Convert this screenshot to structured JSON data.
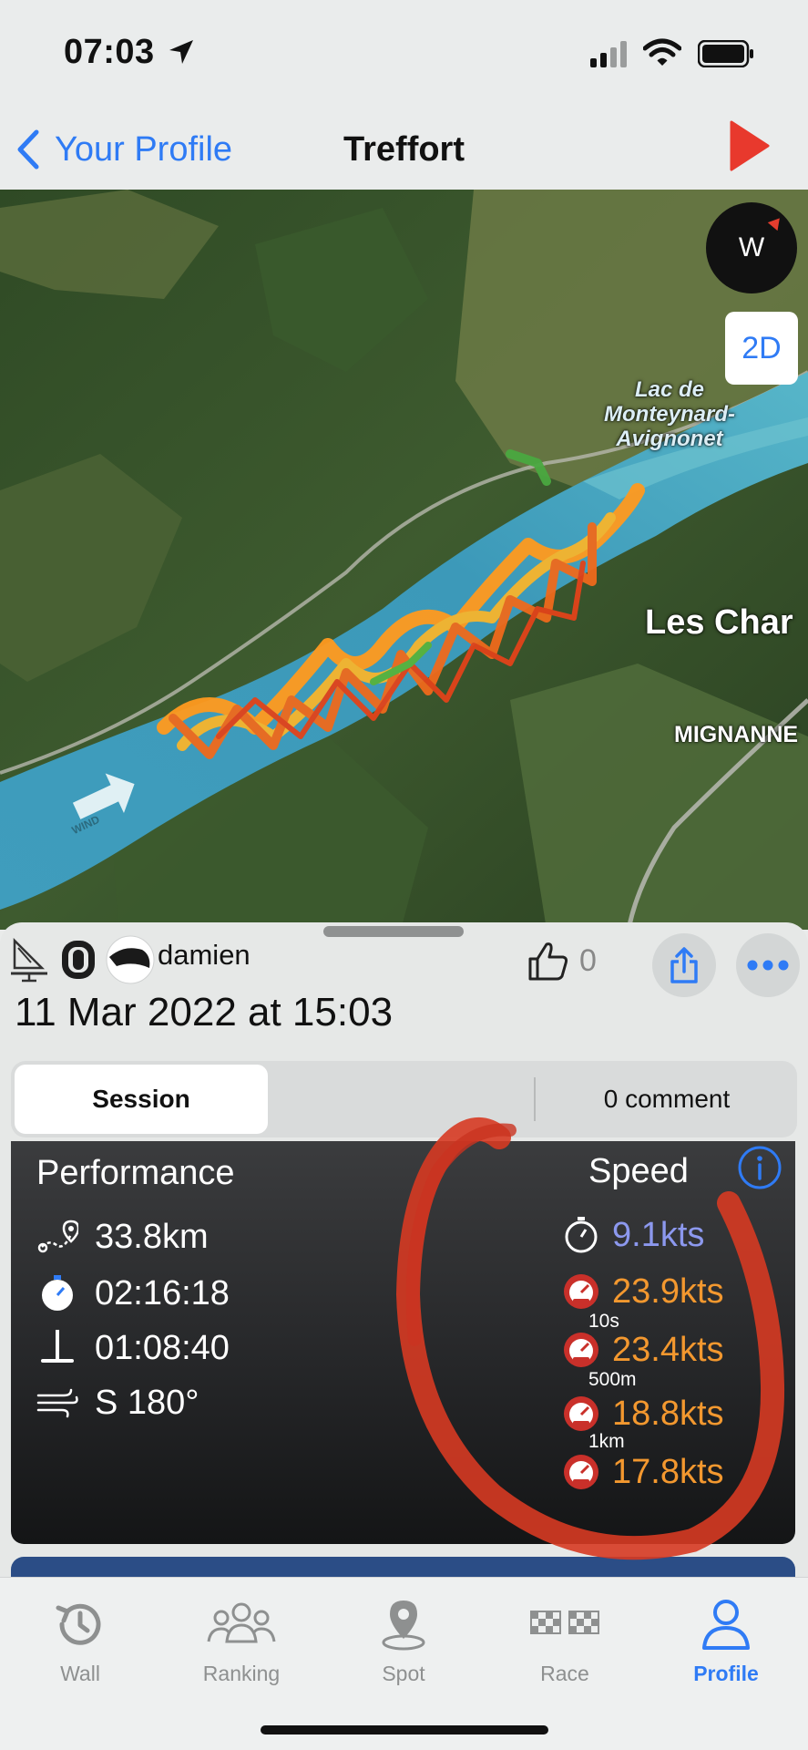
{
  "status_bar": {
    "time": "07:03"
  },
  "nav": {
    "back_label": "Your Profile",
    "title": "Treffort"
  },
  "map": {
    "compass_label": "W",
    "view_mode_label": "2D",
    "lake_label": "Lac de Monteynard-Avignonet",
    "town_label": "Les Char",
    "village_label": "MIGNANNE",
    "wind_label": "WIND"
  },
  "session": {
    "owner": "damien",
    "likes": "0",
    "date": "11 Mar 2022 at 15:03",
    "tabs": {
      "session": "Session",
      "comments": "0 comment"
    }
  },
  "performance": {
    "title": "Performance",
    "distance": "33.8km",
    "duration": "02:16:18",
    "foil_time": "01:08:40",
    "wind": "S 180°"
  },
  "speed": {
    "title": "Speed",
    "average": "9.1kts",
    "max": "23.9kts",
    "max_10s_label": "10s",
    "max_10s": "23.4kts",
    "max_500m_label": "500m",
    "max_500m": "18.8kts",
    "max_1km_label": "1km",
    "max_1km": "17.8kts"
  },
  "tab_bar": {
    "wall": "Wall",
    "ranking": "Ranking",
    "spot": "Spot",
    "race": "Race",
    "profile": "Profile"
  },
  "colors": {
    "accent": "#2f7bf5",
    "speed_orange": "#f3982f",
    "average_blue": "#8c98ee",
    "play_red": "#e8392d",
    "annotation_red": "#d63a22"
  }
}
